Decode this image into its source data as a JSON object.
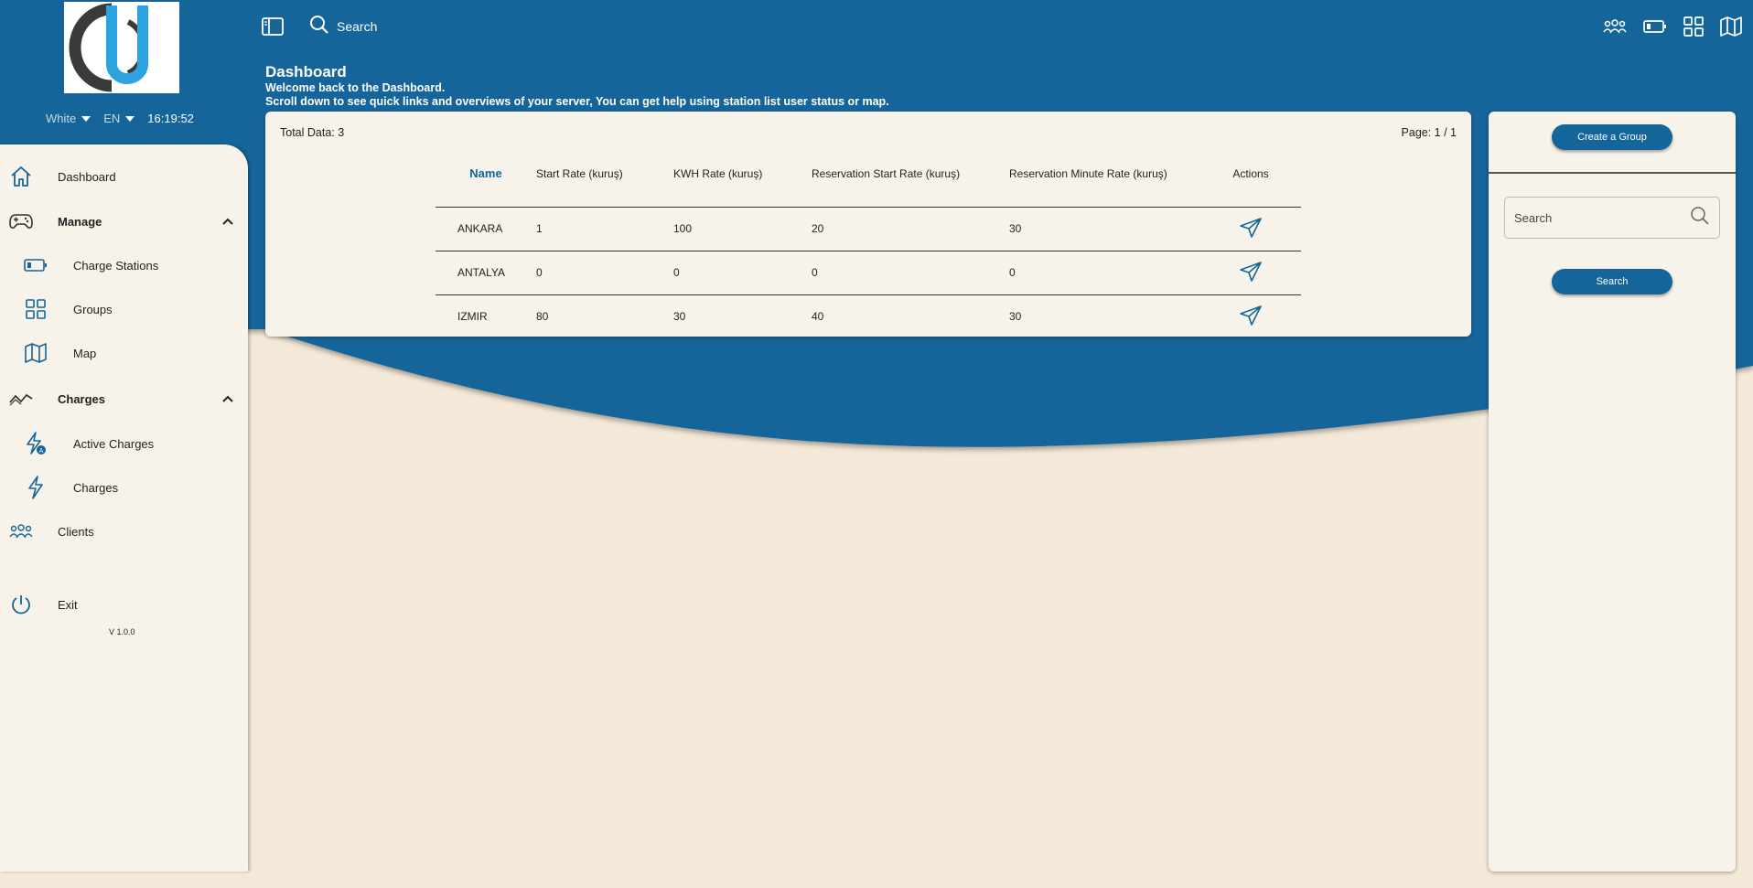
{
  "brand": {
    "primary": "#13659a",
    "bg": "#f4e8d8",
    "panel": "#f8f3ea"
  },
  "topbar": {
    "search_label": "Search",
    "icons": [
      "sidebar-toggle-icon",
      "search-icon",
      "clients-icon",
      "battery-icon",
      "grid-icon",
      "map-icon"
    ]
  },
  "settings": {
    "theme": "White",
    "language": "EN",
    "clock": "16:19:52"
  },
  "sidebar": {
    "dashboard": "Dashboard",
    "manage": "Manage",
    "charge_stations": "Charge Stations",
    "groups": "Groups",
    "map": "Map",
    "charges_group": "Charges",
    "active_charges": "Active Charges",
    "charges": "Charges",
    "clients": "Clients",
    "exit": "Exit",
    "version": "V 1.0.0"
  },
  "header": {
    "title": "Dashboard",
    "welcome": "Welcome back to the Dashboard.",
    "hint": "Scroll down to see quick links and overviews of your server, You can get help using station list user status or map."
  },
  "table": {
    "total": "Total Data: 3",
    "page": "Page: 1 / 1",
    "columns": [
      "Name",
      "Start Rate (kuruş)",
      "KWH Rate (kuruş)",
      "Reservation Start Rate (kuruş)",
      "Reservation Minute Rate (kuruş)",
      "Actions"
    ],
    "rows": [
      [
        "ANKARA",
        "1",
        "100",
        "20",
        "30"
      ],
      [
        "ANTALYA",
        "0",
        "0",
        "0",
        "0"
      ],
      [
        "IZMIR",
        "80",
        "30",
        "40",
        "30"
      ]
    ]
  },
  "right_panel": {
    "create_group": "Create a Group",
    "search_placeholder": "Search",
    "search_button": "Search"
  }
}
